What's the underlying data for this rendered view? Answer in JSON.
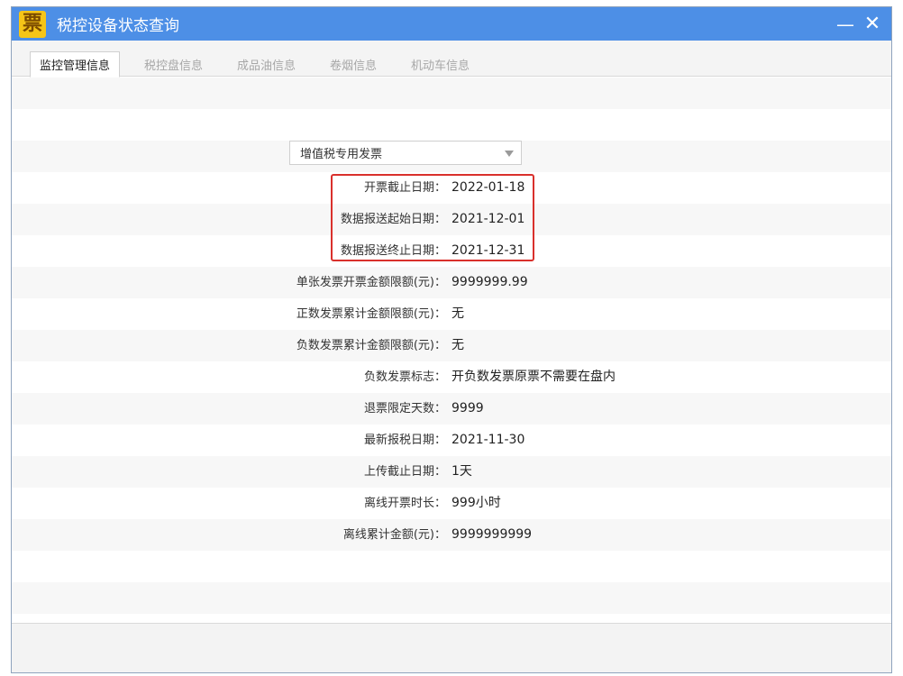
{
  "window": {
    "title": "税控设备状态查询",
    "icon_glyph": "票",
    "minimize_glyph": "—",
    "close_glyph": "✕"
  },
  "tabs": [
    {
      "label": "监控管理信息",
      "active": true
    },
    {
      "label": "税控盘信息",
      "active": false
    },
    {
      "label": "成品油信息",
      "active": false
    },
    {
      "label": "卷烟信息",
      "active": false
    },
    {
      "label": "机动车信息",
      "active": false
    }
  ],
  "invoice_type_select": {
    "selected": "增值税专用发票"
  },
  "fields": [
    {
      "label": "开票截止日期：",
      "value": "2022-01-18"
    },
    {
      "label": "数据报送起始日期：",
      "value": "2021-12-01"
    },
    {
      "label": "数据报送终止日期：",
      "value": "2021-12-31"
    },
    {
      "label": "单张发票开票金额限额(元)：",
      "value": "9999999.99"
    },
    {
      "label": "正数发票累计金额限额(元)：",
      "value": "无"
    },
    {
      "label": "负数发票累计金额限额(元)：",
      "value": "无"
    },
    {
      "label": "负数发票标志：",
      "value": "开负数发票原票不需要在盘内"
    },
    {
      "label": "退票限定天数：",
      "value": "9999"
    },
    {
      "label": "最新报税日期：",
      "value": "2021-11-30"
    },
    {
      "label": "上传截止日期：",
      "value": "1天"
    },
    {
      "label": "离线开票时长：",
      "value": "999小时"
    },
    {
      "label": "离线累计金额(元)：",
      "value": "9999999999"
    }
  ],
  "colors": {
    "titlebar": "#4d8fe6",
    "highlight": "#d9302c",
    "icon_bg": "#f5c518"
  }
}
